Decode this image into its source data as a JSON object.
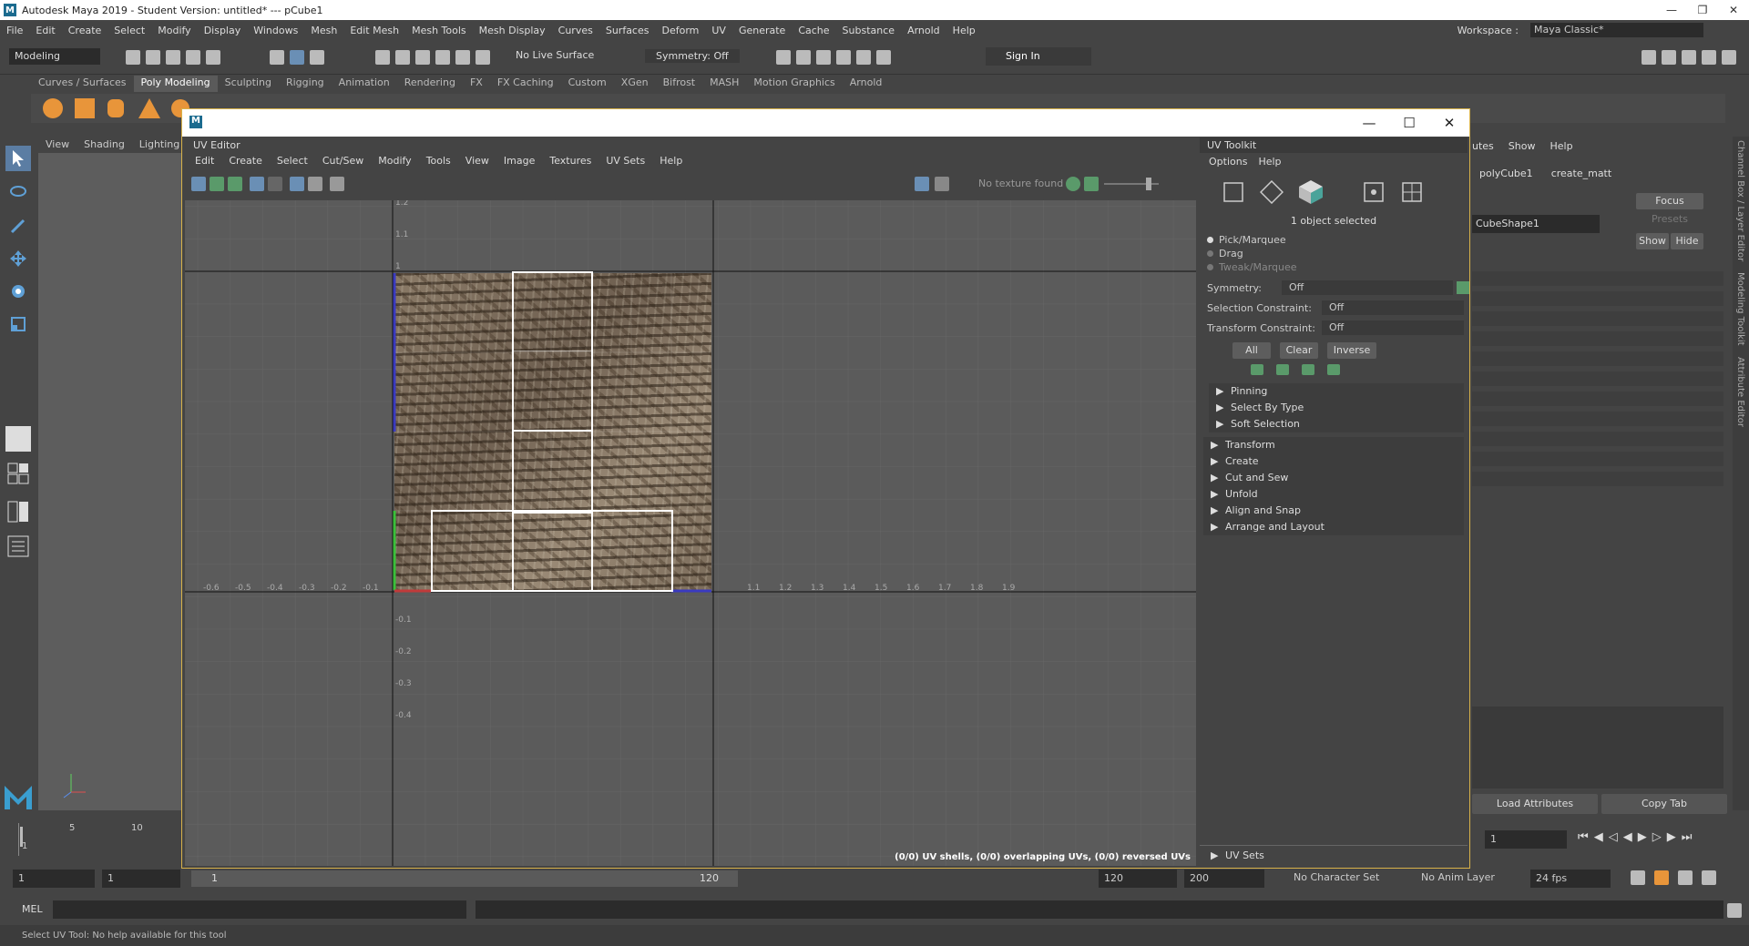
{
  "app": {
    "title": "Autodesk Maya 2019 - Student Version: untitled*   ---   pCube1",
    "logo_letter": "M"
  },
  "menubar": [
    "File",
    "Edit",
    "Create",
    "Select",
    "Modify",
    "Display",
    "Windows",
    "Mesh",
    "Edit Mesh",
    "Mesh Tools",
    "Mesh Display",
    "Curves",
    "Surfaces",
    "Deform",
    "UV",
    "Generate",
    "Cache",
    "Substance",
    "Arnold",
    "Help"
  ],
  "workspace": {
    "label": "Workspace :",
    "value": "Maya Classic*"
  },
  "status": {
    "mode": "Modeling",
    "live_surface": "No Live Surface",
    "symmetry": "Symmetry: Off",
    "sign_in": "Sign In"
  },
  "shelf_tabs": [
    "Curves / Surfaces",
    "Poly Modeling",
    "Sculpting",
    "Rigging",
    "Animation",
    "Rendering",
    "FX",
    "FX Caching",
    "Custom",
    "XGen",
    "Bifrost",
    "MASH",
    "Motion Graphics",
    "Arnold"
  ],
  "shelf_active": "Poly Modeling",
  "viewport_menu": [
    "View",
    "Shading",
    "Lighting"
  ],
  "uv_editor": {
    "title": "UV Editor",
    "menu": [
      "Edit",
      "Create",
      "Select",
      "Cut/Sew",
      "Modify",
      "Tools",
      "View",
      "Image",
      "Textures",
      "UV Sets",
      "Help"
    ],
    "no_texture": "No texture found",
    "shell_info": "(0/0) UV shells, (0/0) overlapping UVs, (0/0) reversed UVs",
    "x_ticks_neg": [
      "-0.6",
      "-0.5",
      "-0.4",
      "-0.3",
      "-0.2",
      "-0.1"
    ],
    "x_ticks_pos": [
      "1.1",
      "1.2",
      "1.3",
      "1.4",
      "1.5",
      "1.6",
      "1.7",
      "1.8",
      "1.9"
    ],
    "y_ticks_pos": [
      "1.2",
      "1.1",
      "1"
    ],
    "y_ticks_neg": [
      "-0.1",
      "-0.2",
      "-0.3",
      "-0.4"
    ]
  },
  "uv_toolkit": {
    "title": "UV Toolkit",
    "menu": [
      "Options",
      "Help"
    ],
    "selected": "1 object selected",
    "modes": [
      "Pick/Marquee",
      "Drag",
      "Tweak/Marquee"
    ],
    "symmetry_label": "Symmetry:",
    "symmetry_value": "Off",
    "sel_constraint_label": "Selection Constraint:",
    "sel_constraint_value": "Off",
    "xform_constraint_label": "Transform Constraint:",
    "xform_constraint_value": "Off",
    "btn_all": "All",
    "btn_clear": "Clear",
    "btn_inverse": "Inverse",
    "sub_sections": [
      "Pinning",
      "Select By Type",
      "Soft Selection"
    ],
    "sections": [
      "Transform",
      "Create",
      "Cut and Sew",
      "Unfold",
      "Align and Snap",
      "Arrange and Layout"
    ],
    "uv_sets": "UV Sets"
  },
  "attr_editor": {
    "menu": [
      "utes",
      "Show",
      "Help"
    ],
    "tabs": [
      "polyCube1",
      "create_matt"
    ],
    "node": "CubeShape1",
    "focus": "Focus",
    "presets": "Presets",
    "show": "Show",
    "hide": "Hide",
    "load": "Load Attributes",
    "copy": "Copy Tab",
    "side_tabs": [
      "Channel Box / Layer Editor",
      "Modeling Toolkit",
      "Attribute Editor"
    ]
  },
  "timeline": {
    "ticks": [
      "5",
      "10"
    ],
    "current_frame": "1",
    "start": "1",
    "start2": "1",
    "range_start": "1",
    "range_end": "120",
    "end": "120",
    "end2": "200",
    "frame_field": "1",
    "char_set": "No Character Set",
    "anim_layer": "No Anim Layer",
    "fps": "24 fps"
  },
  "mel": {
    "label": "MEL"
  },
  "help_line": "Select UV Tool: No help available for this tool"
}
